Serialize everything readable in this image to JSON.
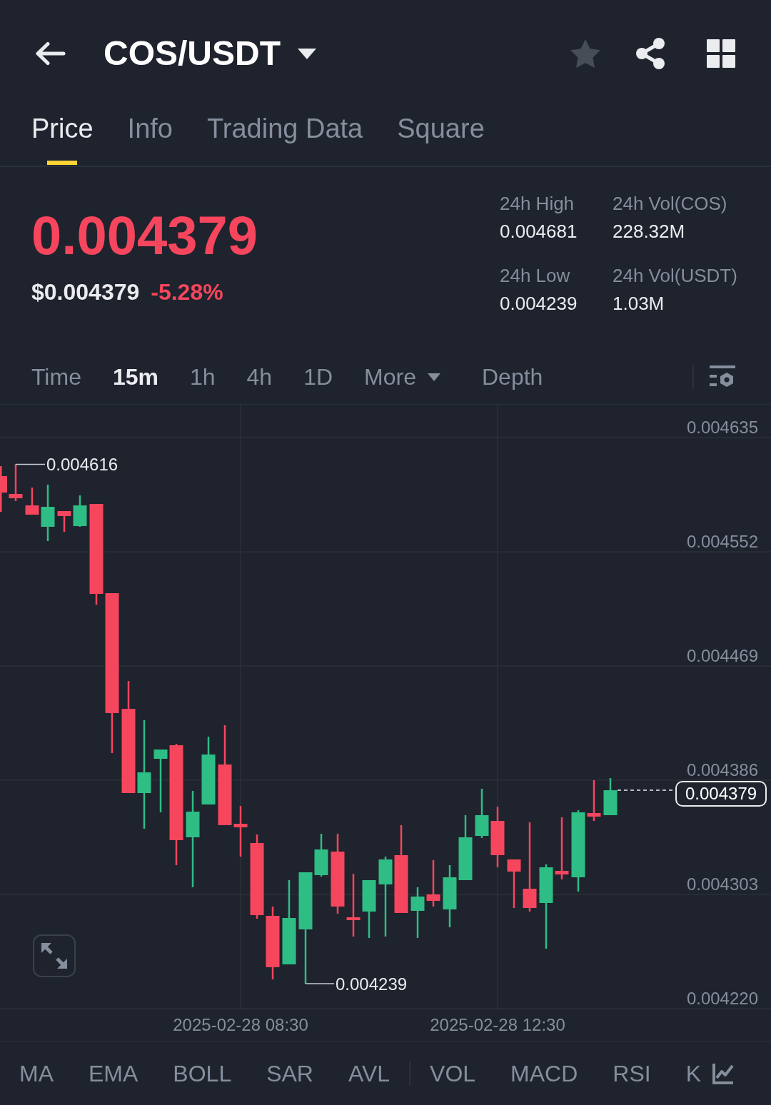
{
  "header": {
    "title": "COS/USDT",
    "favorited": false
  },
  "tabs": [
    {
      "label": "Price",
      "selected": true
    },
    {
      "label": "Info",
      "selected": false
    },
    {
      "label": "Trading Data",
      "selected": false
    },
    {
      "label": "Square",
      "selected": false
    }
  ],
  "ticker": {
    "falling": true,
    "last_price": "0.004379",
    "usd_price": "$0.004379",
    "change": "-5.28%",
    "stats": [
      {
        "label": "24h High",
        "value": "0.004681"
      },
      {
        "label": "24h Vol(COS)",
        "value": "228.32M"
      },
      {
        "label": "24h Low",
        "value": "0.004239"
      },
      {
        "label": "24h Vol(USDT)",
        "value": "1.03M"
      }
    ]
  },
  "intervals": [
    {
      "label": "Time",
      "kind": "option",
      "selected": false
    },
    {
      "label": "15m",
      "kind": "option",
      "selected": true
    },
    {
      "label": "1h",
      "kind": "option",
      "selected": false
    },
    {
      "label": "4h",
      "kind": "option",
      "selected": false
    },
    {
      "label": "1D",
      "kind": "option",
      "selected": false
    },
    {
      "label": "More",
      "kind": "dropdown",
      "selected": false
    },
    {
      "label": "Depth",
      "kind": "option",
      "selected": false
    }
  ],
  "chart": {
    "price_axis": [
      "0.004635",
      "0.004552",
      "0.004469",
      "0.004386",
      "0.004303",
      "0.004220"
    ],
    "high_label": "0.004616",
    "low_label": "0.004239",
    "current_price": "0.004379",
    "time_axis": [
      "2025-02-28 08:30",
      "2025-02-28 12:30"
    ]
  },
  "indicators": {
    "main": [
      {
        "label": "MA",
        "selected": false
      },
      {
        "label": "EMA",
        "selected": false
      },
      {
        "label": "BOLL",
        "selected": false
      },
      {
        "label": "SAR",
        "selected": false
      },
      {
        "label": "AVL",
        "selected": false
      }
    ],
    "sub": [
      {
        "label": "VOL",
        "selected": false
      },
      {
        "label": "MACD",
        "selected": false
      },
      {
        "label": "RSI",
        "selected": false
      },
      {
        "label": "K",
        "selected": false
      }
    ]
  }
}
